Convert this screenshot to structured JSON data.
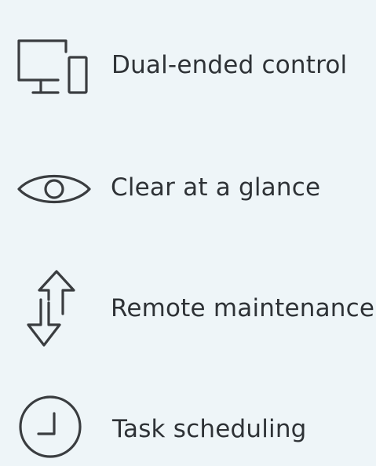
{
  "features": [
    {
      "label": "Dual-ended control",
      "icon": "devices-icon"
    },
    {
      "label": "Clear at a glance",
      "icon": "eye-icon"
    },
    {
      "label": "Remote maintenance",
      "icon": "transfer-arrows-icon"
    },
    {
      "label": "Task scheduling",
      "icon": "clock-icon"
    }
  ],
  "colors": {
    "background": "#eef5f8",
    "icon": "#3a3d40",
    "text": "#2e3236"
  }
}
